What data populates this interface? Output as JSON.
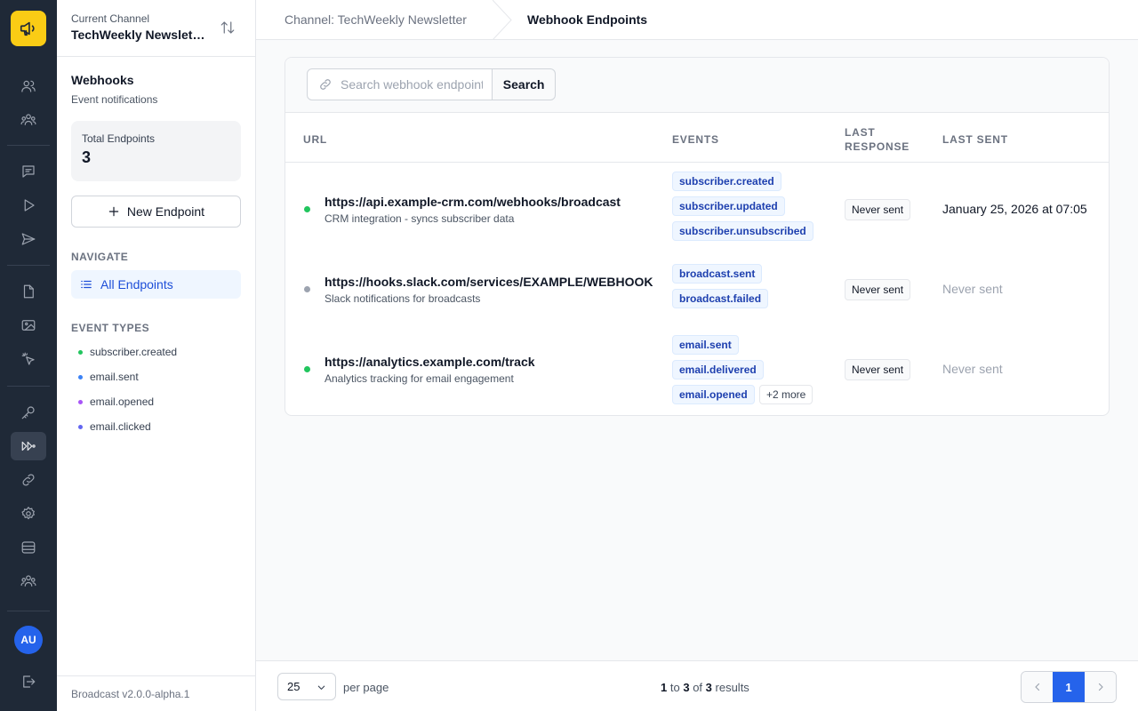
{
  "rail": {
    "avatar_initials": "AU",
    "items": [
      "users-icon",
      "team-icon",
      "chat-icon",
      "play-icon",
      "send-icon",
      "file-icon",
      "image-icon",
      "cursor-click-icon",
      "key-icon",
      "webhook-icon",
      "link-icon",
      "settings-icon",
      "database-icon",
      "group-icon",
      "logout-icon"
    ]
  },
  "sidebar": {
    "channel_label": "Current Channel",
    "channel_name": "TechWeekly Newsletter",
    "section_title": "Webhooks",
    "section_subtitle": "Event notifications",
    "stat_label": "Total Endpoints",
    "stat_value": "3",
    "new_button": "New Endpoint",
    "navigate_heading": "NAVIGATE",
    "nav_all": "All Endpoints",
    "event_types_heading": "EVENT TYPES",
    "event_types": [
      {
        "label": "subscriber.created",
        "color": "#22c55e"
      },
      {
        "label": "email.sent",
        "color": "#3b82f6"
      },
      {
        "label": "email.opened",
        "color": "#a855f7"
      },
      {
        "label": "email.clicked",
        "color": "#6366f1"
      }
    ],
    "version": "Broadcast v2.0.0-alpha.1"
  },
  "header": {
    "crumb_channel": "Channel: TechWeekly Newsletter",
    "crumb_current": "Webhook Endpoints"
  },
  "search": {
    "placeholder": "Search webhook endpoints",
    "button": "Search"
  },
  "table": {
    "headers": {
      "url": "URL",
      "events": "EVENTS",
      "last_response_1": "LAST",
      "last_response_2": "RESPONSE",
      "last_sent": "LAST SENT"
    },
    "rows": [
      {
        "url": "https://api.example-crm.com/webhooks/broadcast",
        "description": "CRM integration - syncs subscriber data",
        "status_color": "#22c55e",
        "events": [
          "subscriber.created",
          "subscriber.updated",
          "subscriber.unsubscribed"
        ],
        "more": "",
        "last_response": "Never sent",
        "last_sent": "January 25, 2026 at 07:05"
      },
      {
        "url": "https://hooks.slack.com/services/EXAMPLE/WEBHOOK",
        "description": "Slack notifications for broadcasts",
        "status_color": "#9ca3af",
        "events": [
          "broadcast.sent",
          "broadcast.failed"
        ],
        "more": "",
        "last_response": "Never sent",
        "last_sent": "Never sent"
      },
      {
        "url": "https://analytics.example.com/track",
        "description": "Analytics tracking for email engagement",
        "status_color": "#22c55e",
        "events": [
          "email.sent",
          "email.delivered",
          "email.opened"
        ],
        "more": "+2 more",
        "last_response": "Never sent",
        "last_sent": "Never sent"
      }
    ]
  },
  "footer": {
    "per_page_value": "25",
    "per_page_label": "per page",
    "from": "1",
    "to_word": "to",
    "to": "3",
    "of_word": "of",
    "total": "3",
    "results_word": "results",
    "current_page": "1"
  }
}
